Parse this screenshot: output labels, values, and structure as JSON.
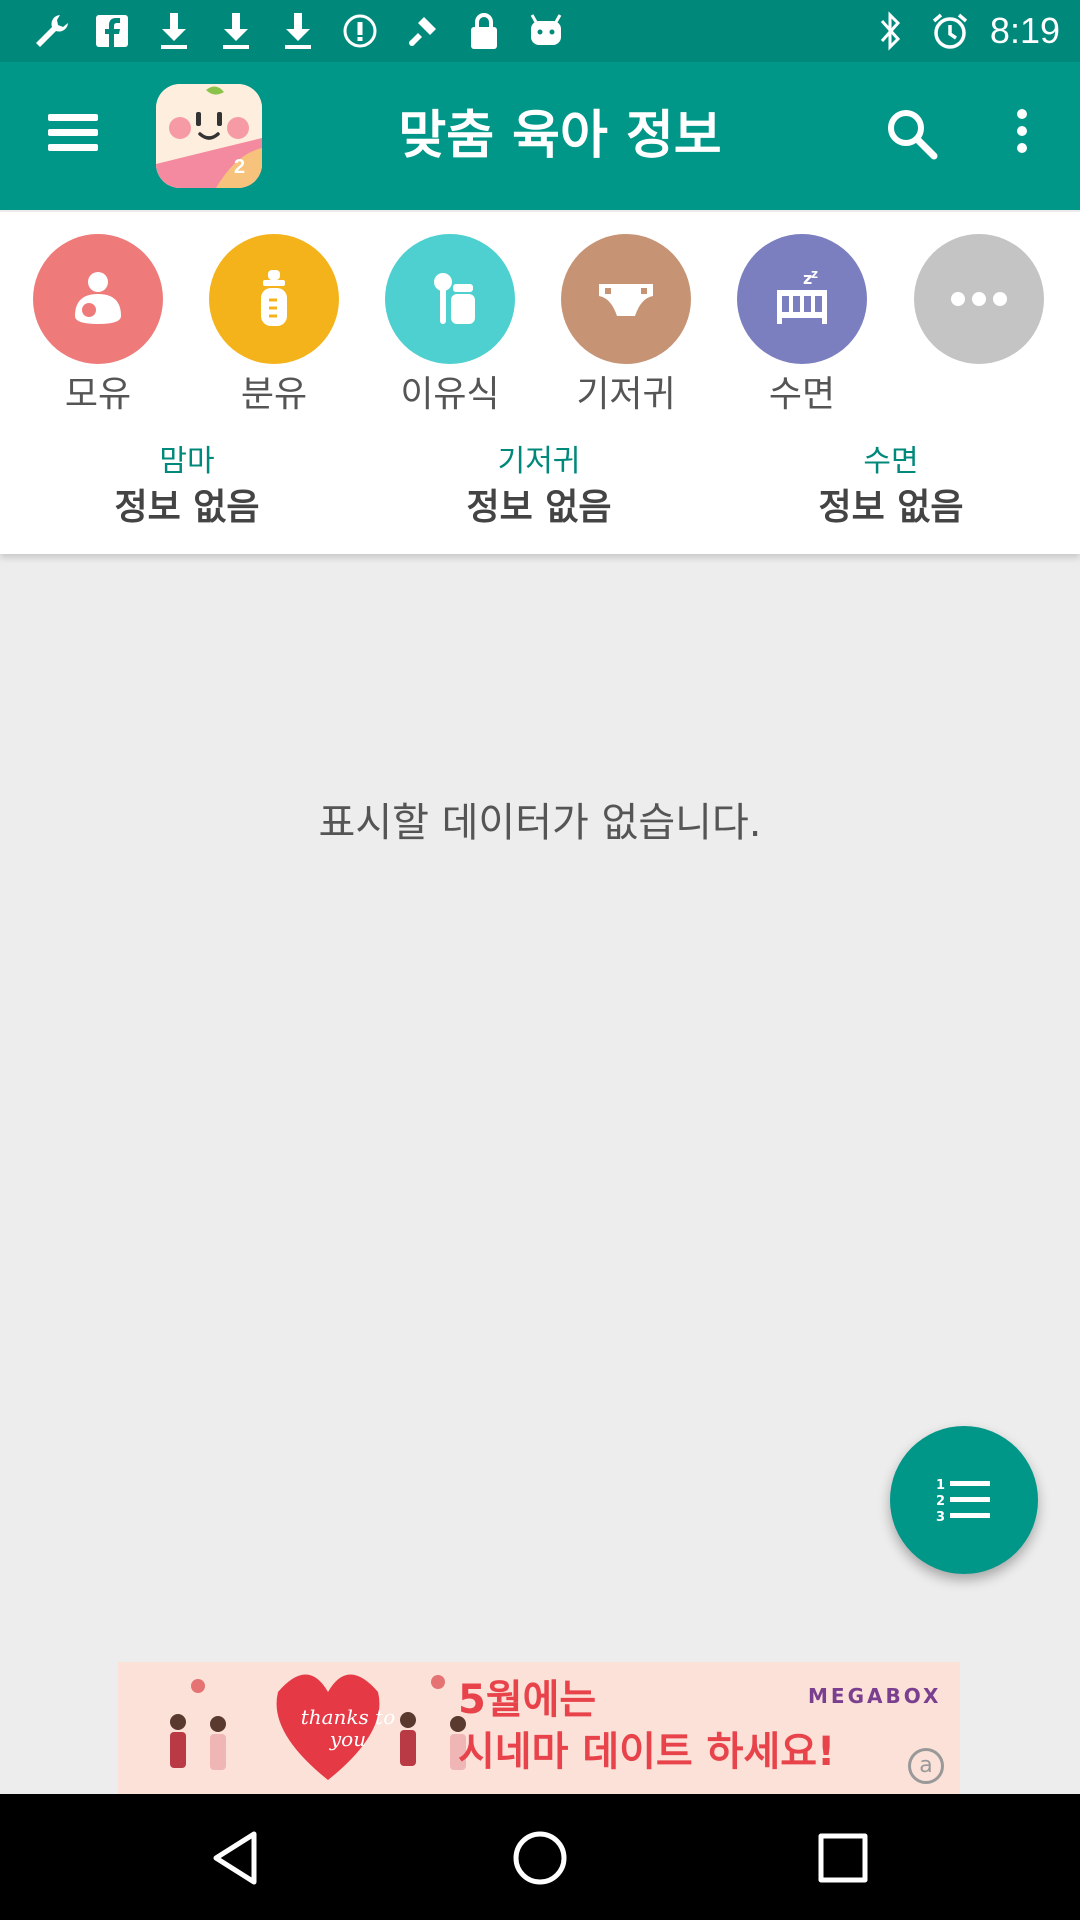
{
  "status_bar": {
    "time": "8:19",
    "left_icons": [
      "wrench-icon",
      "facebook-icon",
      "download-icon",
      "download-icon",
      "download-icon",
      "info-icon",
      "fake-gps-icon",
      "lock-icon",
      "android-icon"
    ],
    "right_icons": [
      "bluetooth-icon",
      "alarm-icon"
    ]
  },
  "app_bar": {
    "title": "맞춤 육아 정보",
    "logo_badge": "2"
  },
  "categories": [
    {
      "label": "모유",
      "color": "#ef7a7a",
      "icon": "breastfeeding-icon"
    },
    {
      "label": "분유",
      "color": "#f4b31b",
      "icon": "baby-bottle-icon"
    },
    {
      "label": "이유식",
      "color": "#4dd0cf",
      "icon": "baby-food-icon"
    },
    {
      "label": "기저귀",
      "color": "#c69474",
      "icon": "diaper-icon"
    },
    {
      "label": "수면",
      "color": "#7b7fbf",
      "icon": "crib-sleep-icon"
    },
    {
      "label": "",
      "color": "#c4c4c4",
      "icon": "more-horizontal-icon"
    }
  ],
  "stats": [
    {
      "title": "맘마",
      "value": "정보 없음"
    },
    {
      "title": "기저귀",
      "value": "정보 없음"
    },
    {
      "title": "수면",
      "value": "정보 없음"
    }
  ],
  "main": {
    "empty_message": "표시할 데이터가 없습니다."
  },
  "ad": {
    "text_line1": "5월에는",
    "text_line2": "시네마 데이트 하세요!",
    "brand": "MEGABOX",
    "heart_text": "thanks to you"
  },
  "colors": {
    "primary": "#009688",
    "status_bar": "#00897b",
    "accent_text": "#00897b"
  }
}
